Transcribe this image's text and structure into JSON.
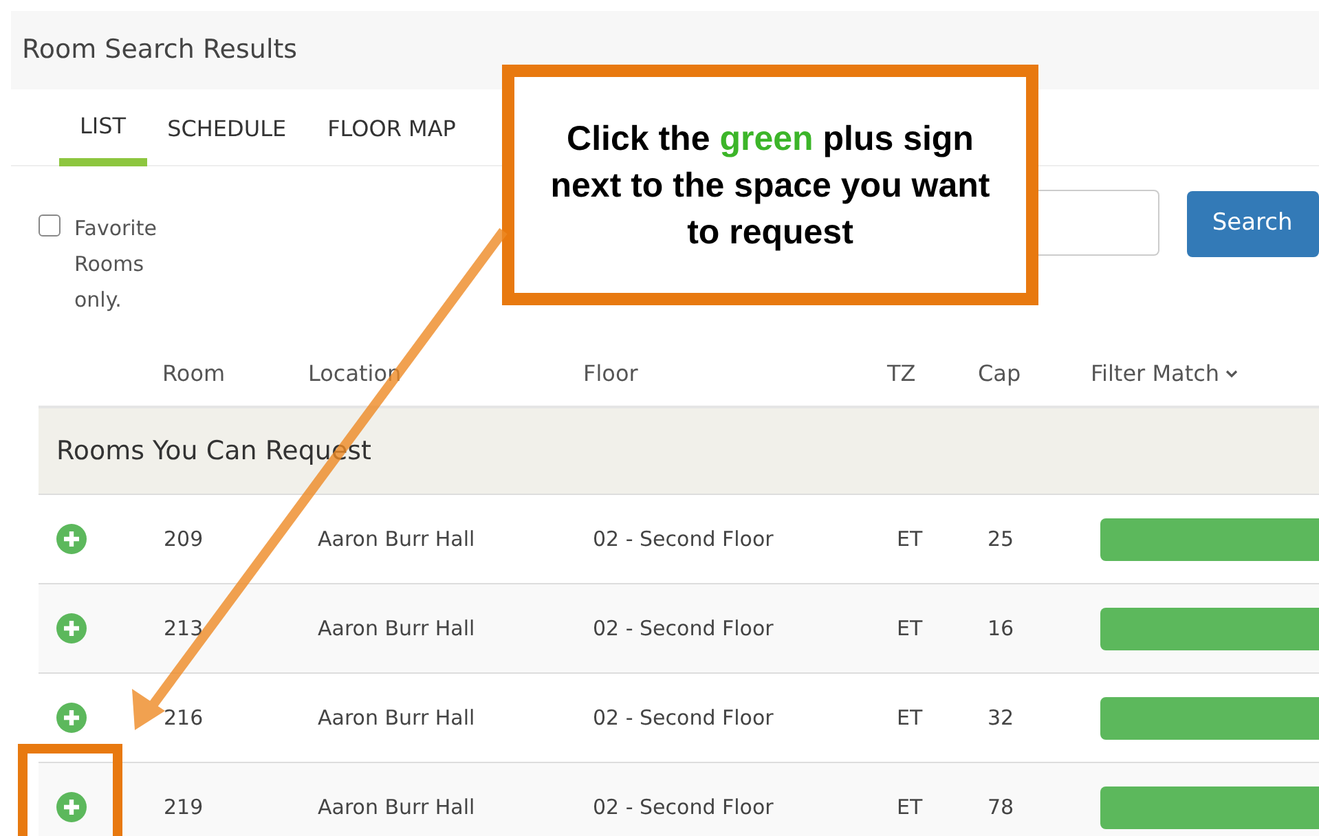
{
  "page": {
    "title": "Room Search Results"
  },
  "tabs": [
    {
      "label": "LIST",
      "selected": true
    },
    {
      "label": "SCHEDULE",
      "selected": false
    },
    {
      "label": "FLOOR MAP",
      "selected": false
    }
  ],
  "favorites_filter": {
    "label": "Favorite Rooms only.",
    "checked": false
  },
  "search_button": "Search",
  "table": {
    "columns": [
      "Room",
      "Location",
      "Floor",
      "TZ",
      "Cap",
      "Filter Match"
    ],
    "group": "Rooms You Can Request",
    "rows": [
      {
        "room": "209",
        "location": "Aaron Burr Hall",
        "floor": "02 - Second Floor",
        "tz": "ET",
        "cap": "25"
      },
      {
        "room": "213",
        "location": "Aaron Burr Hall",
        "floor": "02 - Second Floor",
        "tz": "ET",
        "cap": "16"
      },
      {
        "room": "216",
        "location": "Aaron Burr Hall",
        "floor": "02 - Second Floor",
        "tz": "ET",
        "cap": "32"
      },
      {
        "room": "219",
        "location": "Aaron Burr Hall",
        "floor": "02 - Second Floor",
        "tz": "ET",
        "cap": "78"
      }
    ]
  },
  "callout": {
    "before": "Click the",
    "highlight": "green",
    "after": "plus sign next to the space you want to request"
  }
}
